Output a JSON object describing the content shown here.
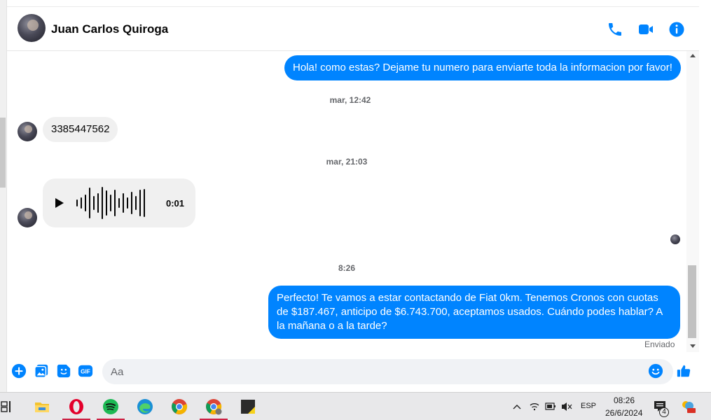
{
  "header": {
    "contact_name": "Juan Carlos Quiroga"
  },
  "conversation": {
    "messages": [
      {
        "direction": "outgoing",
        "text": "Hola! como estas? Dejame tu numero para enviarte toda la informacion por favor!"
      },
      {
        "direction": "timestamp",
        "text": "mar, 12:42"
      },
      {
        "direction": "incoming",
        "text": "3385447562"
      },
      {
        "direction": "timestamp",
        "text": "mar, 21:03"
      },
      {
        "direction": "incoming-audio",
        "duration": "0:01"
      },
      {
        "direction": "timestamp",
        "text": "8:26"
      },
      {
        "direction": "outgoing",
        "text": "Perfecto! Te vamos a estar contactando de Fiat 0km. Tenemos Cronos con cuotas de $187.467, anticipo de $6.743.700, aceptamos usados. Cuándo podes hablar? A la mañana o a la tarde?"
      }
    ],
    "sent_status": "Enviado"
  },
  "composer": {
    "placeholder": "Aa"
  },
  "taskbar": {
    "language": "ESP",
    "time": "08:26",
    "date": "26/6/2024",
    "notification_count": "4"
  },
  "colors": {
    "accent": "#0084ff",
    "incoming_bubble": "#f0f0f0",
    "spotify": "#1db954",
    "opera": "#e3002b"
  }
}
